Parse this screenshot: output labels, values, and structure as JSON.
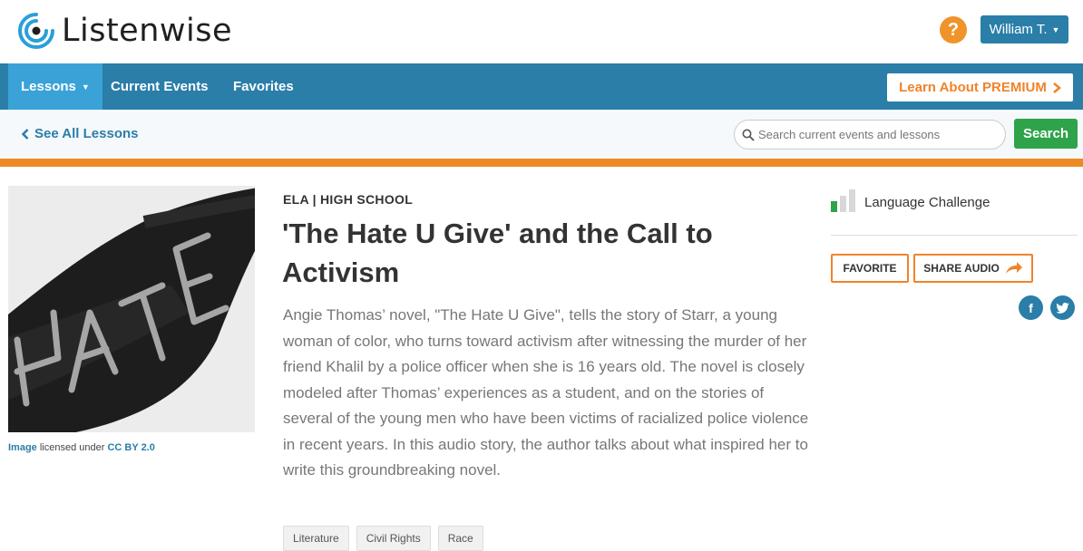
{
  "header": {
    "logo_text": "Listenwise",
    "help_label": "?",
    "user_name": "William T."
  },
  "nav": {
    "items": [
      {
        "label": "Lessons",
        "active": true
      },
      {
        "label": "Current Events",
        "active": false
      },
      {
        "label": "Favorites",
        "active": false
      }
    ],
    "premium_label": "Learn About PREMIUM"
  },
  "subbar": {
    "back_label": "See All Lessons",
    "search_placeholder": "Search current events and lessons",
    "search_button": "Search"
  },
  "lesson": {
    "category": "ELA | HIGH SCHOOL",
    "title": "'The Hate U Give' and the Call to Activism",
    "description": "Angie Thomas’ novel, \"The Hate U Give\", tells the story of Starr, a young woman of color, who turns toward activism after witnessing the murder of her friend Khalil by a police officer when she is 16 years old. The novel is closely modeled after Thomas’ experiences as a student, and on the stories of several of the young men who have been victims of racialized police violence in recent years. In this audio story, the author talks about what inspired her to write this groundbreaking novel.",
    "tags": [
      "Literature",
      "Civil Rights",
      "Race"
    ],
    "image_text": "HATE",
    "credit": {
      "image_link": "Image",
      "mid_text": "licensed under",
      "license_link": "CC BY 2.0"
    }
  },
  "sidebar": {
    "language_challenge": "Language Challenge",
    "favorite_label": "FAVORITE",
    "share_label": "SHARE AUDIO",
    "facebook_glyph": "f",
    "twitter_glyph": "t"
  },
  "colors": {
    "nav_blue": "#2a7ea8",
    "nav_active": "#3aa2d7",
    "accent_orange": "#ec8a25",
    "search_green": "#2ea34a"
  }
}
